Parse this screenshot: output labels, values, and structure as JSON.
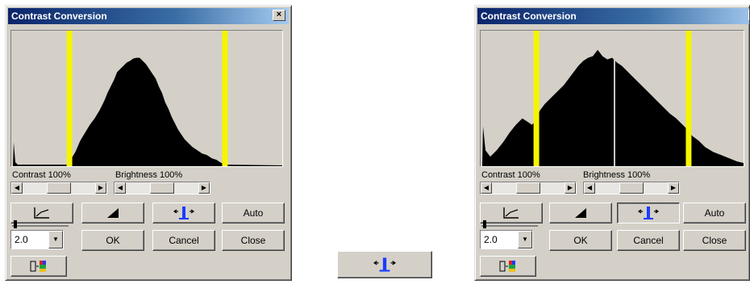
{
  "dialogs": [
    {
      "title": "Contrast Conversion",
      "close_glyph": "×",
      "contrast_label": "Contrast  100%",
      "brightness_label": "Brightness  100%",
      "gamma_value": "2.0",
      "buttons": {
        "auto": "Auto",
        "ok": "OK",
        "cancel": "Cancel",
        "close": "Close"
      },
      "histogram_peak_marker": false
    },
    {
      "title": "Contrast Conversion",
      "close_glyph": "×",
      "contrast_label": "Contrast  100%",
      "brightness_label": "Brightness  100%",
      "gamma_value": "2.0",
      "buttons": {
        "auto": "Auto",
        "ok": "OK",
        "cancel": "Cancel",
        "close": "Close"
      },
      "histogram_peak_marker": true
    }
  ],
  "colors": {
    "title_gradient_start": "#0a246a",
    "level_marker": "#f5f500",
    "histogram_fill": "#000000",
    "icon_blue": "#1a3cff"
  },
  "icons": {
    "curve_button": "curve-graph-icon",
    "invert_button": "invert-triangle-icon",
    "auto_level_button": "blue-peak-arrows-icon",
    "color_channel_button": "color-channel-icon",
    "standalone_button": "blue-peak-arrows-icon"
  }
}
